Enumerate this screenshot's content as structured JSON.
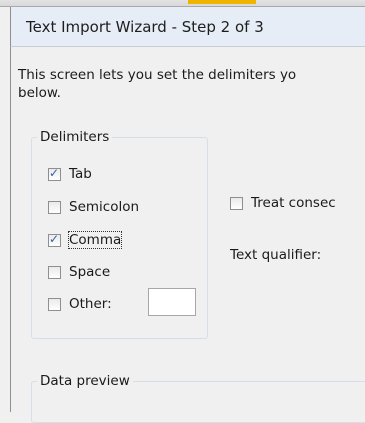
{
  "window": {
    "title": "Text Import Wizard - Step 2 of 3"
  },
  "description": {
    "line1": "This screen lets you set the delimiters yo",
    "line2": "below."
  },
  "delimiters": {
    "legend": "Delimiters",
    "tab": {
      "label": "Tab",
      "checked": true
    },
    "semicolon": {
      "label": "Semicolon",
      "checked": false
    },
    "comma": {
      "label": "Comma",
      "checked": true
    },
    "space": {
      "label": "Space",
      "checked": false
    },
    "other": {
      "label": "Other:",
      "checked": false,
      "value": ""
    }
  },
  "treat_consecutive": {
    "label": "Treat consec",
    "checked": false
  },
  "text_qualifier": {
    "label": "Text qualifier:"
  },
  "data_preview": {
    "legend": "Data preview"
  },
  "colors": {
    "accent": "#f0b400",
    "check": "#3a5fa8",
    "titlebar": "#e6edf6"
  }
}
